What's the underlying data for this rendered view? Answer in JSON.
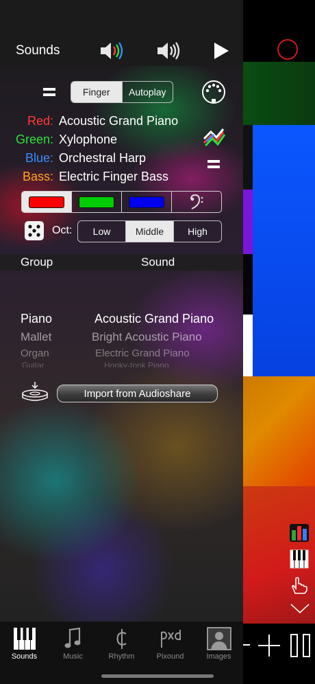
{
  "header": {
    "title": "Sounds",
    "speaker_color_icon": "speaker-color-icon",
    "speaker_icon": "speaker-icon",
    "play_icon": "play-icon"
  },
  "mode": {
    "left_icon": "equals-icon",
    "options": [
      "Finger",
      "Autoplay"
    ],
    "selected": "Finger",
    "midi_icon": "midi-connector-icon"
  },
  "channels": [
    {
      "key": "Red:",
      "value": "Acoustic Grand Piano",
      "color": "#ff3b3b"
    },
    {
      "key": "Green:",
      "value": "Xylophone",
      "color": "#2ee03a"
    },
    {
      "key": "Blue:",
      "value": "Orchestral Harp",
      "color": "#3a8bff"
    },
    {
      "key": "Bass:",
      "value": "Electric Finger Bass",
      "color": "#ffa726"
    }
  ],
  "channel_icons": {
    "shuffle": "shuffle-icon",
    "equals": "equals-icon"
  },
  "color_selector": {
    "swatches": [
      "#ff0000",
      "#00cc00",
      "#0000ee"
    ],
    "bass_icon": "bass-clef-icon",
    "selected_index": 0
  },
  "octave": {
    "dice_icon": "dice-icon",
    "label": "Oct:",
    "options": [
      "Low",
      "Middle",
      "High"
    ],
    "selected": "Middle"
  },
  "picker": {
    "headers": {
      "group": "Group",
      "sound": "Sound"
    },
    "groups": [
      "Piano",
      "Mallet",
      "Organ",
      "Guitar"
    ],
    "sounds": [
      "Acoustic Grand Piano",
      "Bright Acoustic Piano",
      "Electric Grand Piano",
      "Honky-tonk Piano"
    ],
    "selected_index": 0
  },
  "import": {
    "icon": "audioshare-import-icon",
    "label": "Import from Audioshare"
  },
  "side_tools": {
    "record_icon": "record-icon",
    "levels_icon": "levels-icon",
    "keyboard_icon": "keyboard-icon",
    "hand_icon": "hand-pointer-icon",
    "collapse_icon": "chevron-down-icon",
    "zoom_out": "-",
    "zoom_in": "+",
    "pause_icon": "pause-icon"
  },
  "tabs": [
    {
      "label": "Sounds",
      "icon": "piano-keys-icon",
      "selected": true
    },
    {
      "label": "Music",
      "icon": "music-note-icon",
      "selected": false
    },
    {
      "label": "Rhythm",
      "icon": "cut-time-icon",
      "selected": false
    },
    {
      "label": "Pixound",
      "icon": "pixound-logo-icon",
      "selected": false
    },
    {
      "label": "Images",
      "icon": "person-photo-icon",
      "selected": false
    }
  ]
}
